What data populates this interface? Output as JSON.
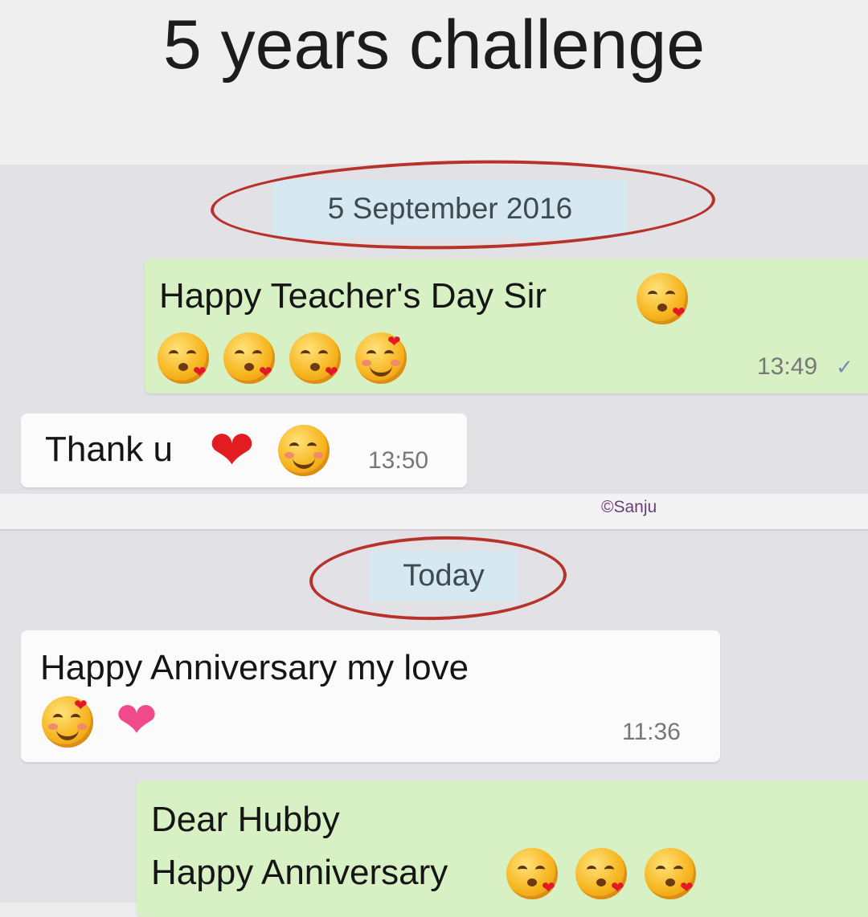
{
  "title": "5 years challenge",
  "watermark": "©Sanju",
  "date_chips": [
    "5 September 2016",
    "Today"
  ],
  "messages": [
    {
      "direction": "outgoing",
      "text": "Happy Teacher's Day Sir",
      "time": "13:49",
      "emojis": [
        "kissing-heart-icon",
        "kissing-heart-icon",
        "kissing-heart-icon",
        "kissing-heart-icon",
        "smiling-hearts-icon"
      ]
    },
    {
      "direction": "incoming",
      "text": "Thank u",
      "time": "13:50",
      "emojis": [
        "red-heart-icon",
        "smiling-blush-icon"
      ]
    },
    {
      "direction": "incoming",
      "text": "Happy Anniversary my love",
      "time": "11:36",
      "emojis": [
        "smiling-hearts-icon",
        "sparkling-heart-icon"
      ]
    },
    {
      "direction": "outgoing",
      "line1": "Dear Hubby",
      "line2": "Happy Anniversary",
      "emojis": [
        "kissing-heart-icon",
        "kissing-heart-icon",
        "kissing-heart-icon"
      ]
    }
  ],
  "colors": {
    "outgoing_bubble": "#d7f1c4",
    "incoming_bubble": "#fbfbfb",
    "date_chip": "#d6e8f1",
    "highlight_ring": "#b8322c"
  }
}
